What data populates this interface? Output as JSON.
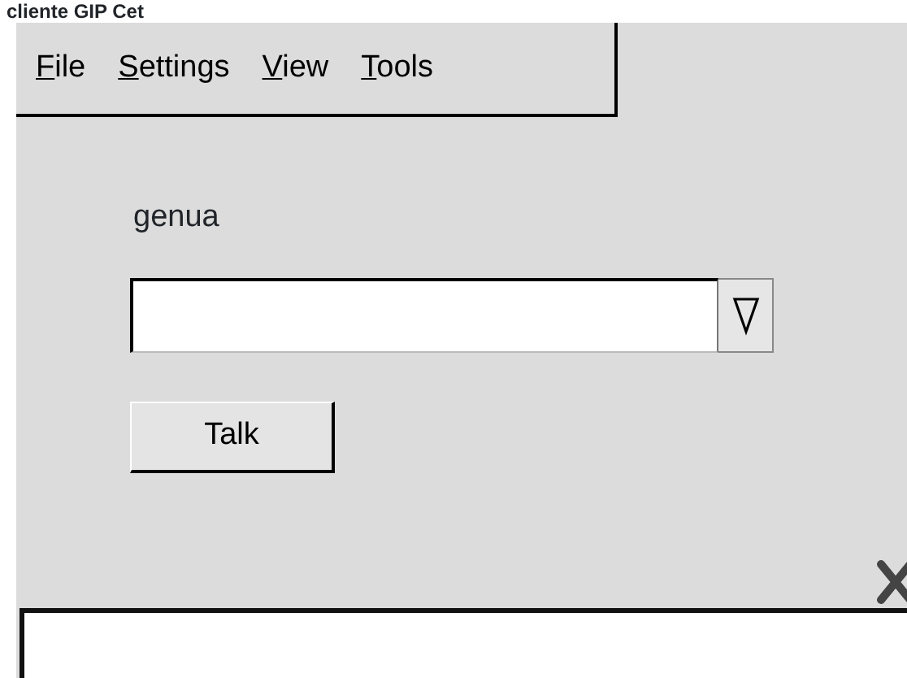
{
  "window": {
    "title": "cliente GIP Cet"
  },
  "menu": [
    {
      "label": "File"
    },
    {
      "label": "Settings"
    },
    {
      "label": "View"
    },
    {
      "label": "Tools"
    }
  ],
  "host_label": "genua",
  "buttons": [
    "Talk"
  ]
}
